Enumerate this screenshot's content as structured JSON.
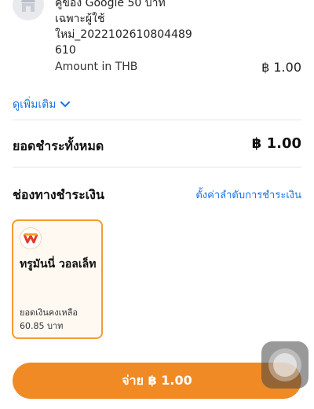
{
  "order": {
    "store_icon": "store-icon",
    "item_title_lines": [
      "คู่ของ Google 50 บาท",
      "เฉพาะผู้ใช้",
      "ใหม่_2022102610804489",
      "610"
    ],
    "amount_label": "Amount in THB",
    "amount_value": "฿ 1.00",
    "more_link": "ดูเพิ่มเติม",
    "more_icon": "chevron-down-icon"
  },
  "total": {
    "label": "ยอดชำระทั้งหมด",
    "value": "฿ 1.00"
  },
  "payment_methods": {
    "title": "ช่องทางชำระเงิน",
    "reorder_link": "ตั้งค่าลำดับการชำระเงิน",
    "selected": {
      "name": "ทรูมันนี่ วอลเล็ท",
      "logo": "truemoney-logo-icon",
      "balance_label": "ยอดเงินคงเหลือ",
      "balance_value": "60.85 บาท"
    }
  },
  "pay_button": {
    "label": "จ่าย ฿ 1.00"
  },
  "colors": {
    "accent": "#f08a24",
    "link": "#1a73e8",
    "card_border": "#f39c35"
  }
}
